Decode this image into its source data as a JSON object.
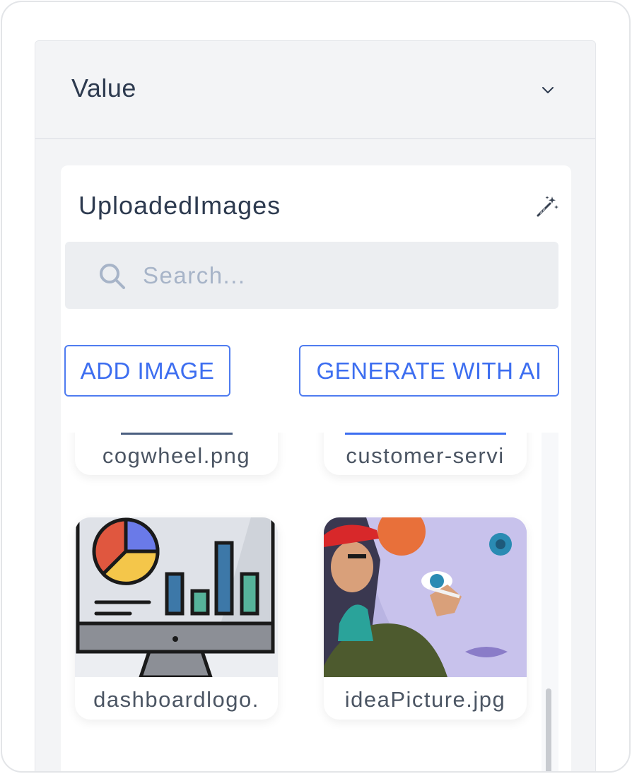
{
  "panel": {
    "title": "Value"
  },
  "images_card": {
    "title": "UploadedImages",
    "search_placeholder": "Search...",
    "add_image_label": "ADD IMAGE",
    "generate_label": "GENERATE WITH AI"
  },
  "gallery": {
    "items": [
      {
        "name": "cogwheel.png"
      },
      {
        "name": "customer-servi"
      },
      {
        "name": "dashboardlogo."
      },
      {
        "name": "ideaPicture.jpg"
      }
    ]
  },
  "colors": {
    "accent": "#3d6ef0",
    "panel_bg": "#f3f4f6",
    "text": "#2d3a4f",
    "placeholder": "#a7b4c8"
  },
  "icons": [
    "chevron-down-icon",
    "magic-wand-icon",
    "search-icon"
  ]
}
